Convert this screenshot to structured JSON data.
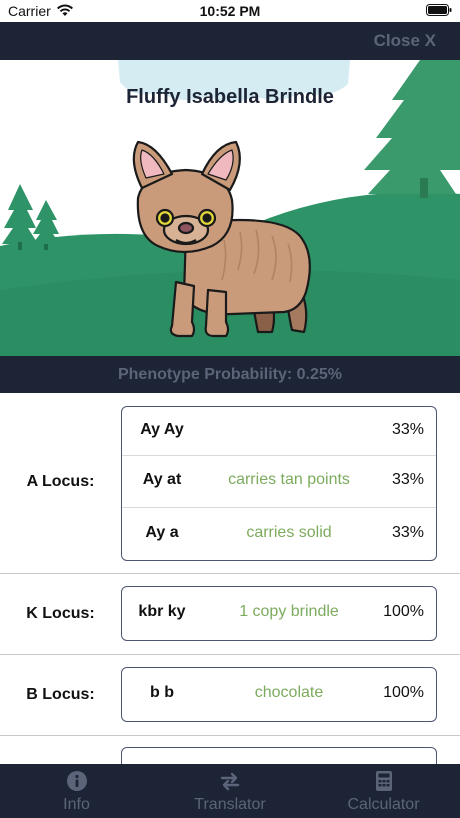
{
  "status_bar": {
    "carrier": "Carrier",
    "time": "10:52 PM"
  },
  "nav": {
    "close_label": "Close X"
  },
  "hero": {
    "title": "Fluffy Isabella Brindle"
  },
  "probability": {
    "text": "Phenotype Probability: 0.25%"
  },
  "loci": [
    {
      "label": "A Locus:",
      "rows": [
        {
          "genotype": "Ay Ay",
          "phenotype": "",
          "percent": "33%"
        },
        {
          "genotype": "Ay at",
          "phenotype": "carries tan points",
          "percent": "33%"
        },
        {
          "genotype": "Ay a",
          "phenotype": "carries solid",
          "percent": "33%"
        }
      ]
    },
    {
      "label": "K Locus:",
      "rows": [
        {
          "genotype": "kbr ky",
          "phenotype": "1 copy brindle",
          "percent": "100%"
        }
      ]
    },
    {
      "label": "B Locus:",
      "rows": [
        {
          "genotype": "b b",
          "phenotype": "chocolate",
          "percent": "100%"
        }
      ]
    }
  ],
  "tabs": [
    {
      "label": "Info",
      "icon": "info-icon"
    },
    {
      "label": "Translator",
      "icon": "arrows-swap-icon"
    },
    {
      "label": "Calculator",
      "icon": "calculator-icon"
    }
  ],
  "colors": {
    "nav_background": "#1d2435",
    "muted_text": "#5b6478",
    "phenotype_text": "#7cab5e",
    "hill_green": "#2e9467",
    "tree_green": "#3a9a6c"
  }
}
